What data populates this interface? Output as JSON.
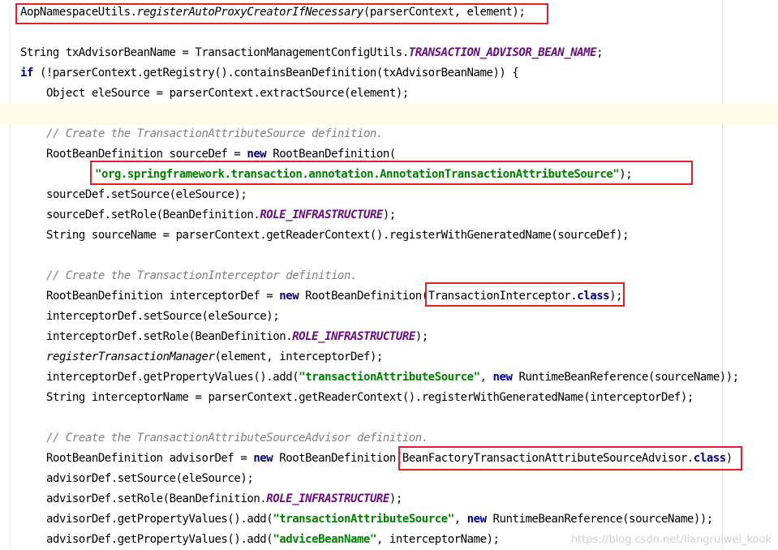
{
  "code": {
    "l1": {
      "a": "AopNamespaceUtils.",
      "b": "registerAutoProxyCreatorIfNecessary",
      "c": "(parserContext, element);"
    },
    "l2": {
      "a": "String txAdvisorBeanName = TransactionManagementConfigUtils.",
      "b": "TRANSACTION_ADVISOR_BEAN_NAME",
      "c": ";"
    },
    "l3": {
      "a": "if",
      "b": " (!parserContext.getRegistry().containsBeanDefinition(txAdvisorBeanName)) {"
    },
    "l4": {
      "a": "Object eleSource = parserContext.extractSource(element);"
    },
    "l5": {
      "a": "// Create the TransactionAttributeSource definition."
    },
    "l6": {
      "a": "RootBeanDefinition sourceDef = ",
      "b": "new",
      "c": " RootBeanDefinition("
    },
    "l7": {
      "a": "\"org.springframework.transaction.annotation.AnnotationTransactionAttributeSource\"",
      "b": ");"
    },
    "l8": {
      "a": "sourceDef.setSource(eleSource);"
    },
    "l9": {
      "a": "sourceDef.setRole(BeanDefinition.",
      "b": "ROLE_INFRASTRUCTURE",
      "c": ");"
    },
    "l10": {
      "a": "String sourceName = parserContext.getReaderContext().registerWithGeneratedName(sourceDef);"
    },
    "l11": {
      "a": "// Create the TransactionInterceptor definition."
    },
    "l12": {
      "a": "RootBeanDefinition interceptorDef = ",
      "b": "new",
      "c": " RootBeanDefinition(",
      "d": "TransactionInterceptor.",
      "e": "class",
      "f": ");"
    },
    "l13": {
      "a": "interceptorDef.setSource(eleSource);"
    },
    "l14": {
      "a": "interceptorDef.setRole(BeanDefinition.",
      "b": "ROLE_INFRASTRUCTURE",
      "c": ");"
    },
    "l15": {
      "a": "registerTransactionManager",
      "b": "(element, interceptorDef);"
    },
    "l16": {
      "a": "interceptorDef.getPropertyValues().add(",
      "b": "\"transactionAttributeSource\"",
      "c": ", ",
      "d": "new",
      "e": " RuntimeBeanReference(sourceName));"
    },
    "l17": {
      "a": "String interceptorName = parserContext.getReaderContext().registerWithGeneratedName(interceptorDef);"
    },
    "l18": {
      "a": "// Create the TransactionAttributeSourceAdvisor definition."
    },
    "l19": {
      "a": "RootBeanDefinition advisorDef = ",
      "b": "new",
      "c": " RootBeanDefinition(",
      "d": "BeanFactoryTransactionAttributeSourceAdvisor.",
      "e": "class",
      "f": ")"
    },
    "l20": {
      "a": "advisorDef.setSource(eleSource);"
    },
    "l21": {
      "a": "advisorDef.setRole(BeanDefinition.",
      "b": "ROLE_INFRASTRUCTURE",
      "c": ");"
    },
    "l22": {
      "a": "advisorDef.getPropertyValues().add(",
      "b": "\"transactionAttributeSource\"",
      "c": ", ",
      "d": "new",
      "e": " RuntimeBeanReference(sourceName));"
    },
    "l23": {
      "a": "advisorDef.getPropertyValues().add(",
      "b": "\"adviceBeanName\"",
      "c": ", interceptorName);"
    }
  },
  "watermark": "https://blog.csdn.net/liangruiwei_kook",
  "colors": {
    "keyword": "#000080",
    "string": "#008000",
    "comment": "#808080",
    "constant": "#660e7a",
    "highlight_box": "#e0202a",
    "caret_row": "#fffae3"
  }
}
